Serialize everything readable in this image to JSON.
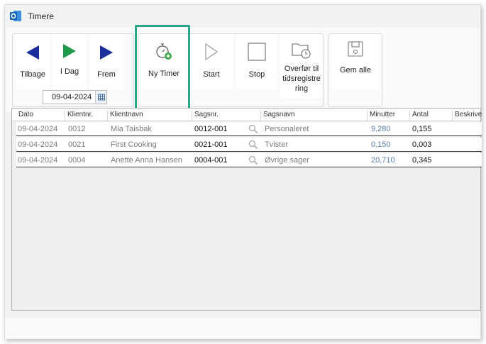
{
  "window": {
    "title": "Timere",
    "icon": "outlook-icon"
  },
  "toolbar": {
    "back_label": "Tilbage",
    "today_label": "I Dag",
    "forward_label": "Frem",
    "date_value": "09-04-2024",
    "new_timer_label": "Ny Timer",
    "start_label": "Start",
    "stop_label": "Stop",
    "transfer_label_lines": [
      "Overfør til",
      "tidsregistre",
      "ring"
    ],
    "save_all_label": "Gem alle"
  },
  "table": {
    "headers": [
      "Dato",
      "Klientnr.",
      "Klientnavn",
      "Sagsnr.",
      "Sagsnavn",
      "Minutter",
      "Antal",
      "Beskrive"
    ],
    "rows": [
      {
        "dato": "09-04-2024",
        "klientnr": "0012",
        "klientnavn": "Mia Taisbak",
        "sagsnr": "0012-001",
        "sagsnavn": "Personaleret",
        "minutter": "9,280",
        "antal": "0,155"
      },
      {
        "dato": "09-04-2024",
        "klientnr": "0021",
        "klientnavn": "First Cooking",
        "sagsnr": "0021-001",
        "sagsnavn": "Tvister",
        "minutter": "0,150",
        "antal": "0,003"
      },
      {
        "dato": "09-04-2024",
        "klientnr": "0004",
        "klientnavn": "Anette Anna Hansen",
        "sagsnr": "0004-001",
        "sagsnavn": "Øvrige sager",
        "minutter": "20,710",
        "antal": "0,345"
      }
    ]
  },
  "colors": {
    "accent_green": "#2aa688",
    "arrow_blue": "#1a2f9b",
    "arrow_green": "#1f9a4a"
  }
}
